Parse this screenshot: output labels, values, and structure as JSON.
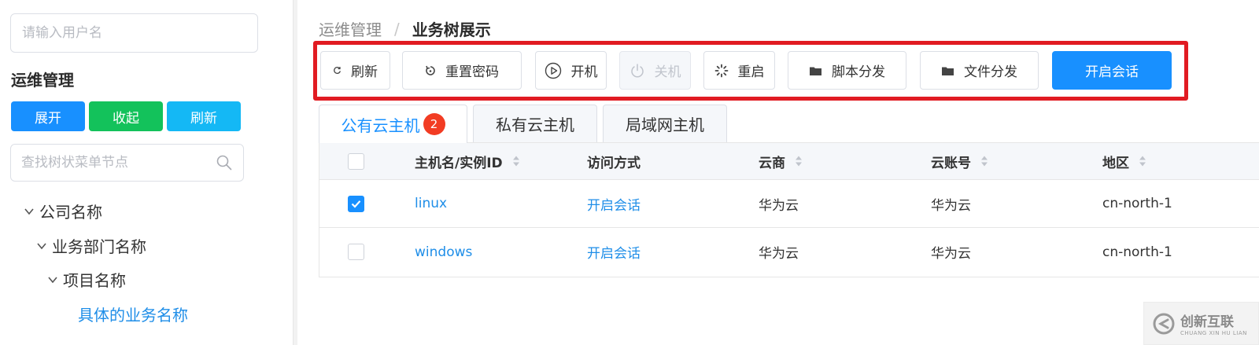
{
  "sidebar": {
    "user_input_placeholder": "请输入用户名",
    "group_title": "运维管理",
    "buttons": {
      "expand": "展开",
      "collapse": "收起",
      "refresh": "刷新"
    },
    "tree_search_placeholder": "查找树状菜单节点",
    "tree": [
      {
        "label": "公司名称",
        "expanded": true
      },
      {
        "label": "业务部门名称",
        "expanded": true
      },
      {
        "label": "项目名称",
        "expanded": true
      },
      {
        "label": "具体的业务名称",
        "selected": true
      }
    ]
  },
  "breadcrumb": {
    "parent": "运维管理",
    "separator": "/",
    "current": "业务树展示"
  },
  "toolbar": {
    "refresh": "刷新",
    "reset_password": "重置密码",
    "power_on": "开机",
    "power_off": "关机",
    "reboot": "重启",
    "script_distribute": "脚本分发",
    "file_distribute": "文件分发",
    "open_session": "开启会话"
  },
  "tabs": [
    {
      "label": "公有云主机",
      "badge": "2",
      "active": true
    },
    {
      "label": "私有云主机"
    },
    {
      "label": "局域网主机"
    }
  ],
  "table": {
    "columns": [
      "主机名/实例ID",
      "访问方式",
      "云商",
      "云账号",
      "地区"
    ],
    "rows": [
      {
        "checked": true,
        "host": "linux",
        "access": "开启会话",
        "cloud": "华为云",
        "account": "华为云",
        "region": "cn-north-1"
      },
      {
        "checked": false,
        "host": "windows",
        "access": "开启会话",
        "cloud": "华为云",
        "account": "华为云",
        "region": "cn-north-1"
      }
    ]
  },
  "watermark": {
    "cn": "创新互联",
    "en": "CHUANG XIN HU LIAN"
  },
  "colors": {
    "primary": "#1890ff",
    "success": "#13c25b",
    "info": "#14b8f5",
    "highlight_frame": "#e11b22",
    "badge": "#f23c23"
  }
}
